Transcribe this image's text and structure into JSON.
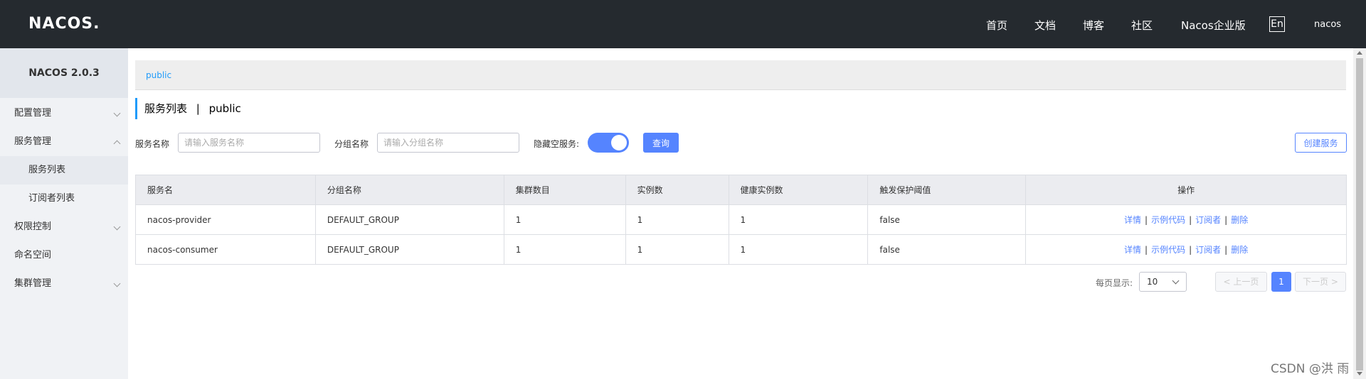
{
  "header": {
    "logo": "NACOS.",
    "nav": [
      "首页",
      "文档",
      "博客",
      "社区",
      "Nacos企业版"
    ],
    "lang": "En",
    "user": "nacos"
  },
  "sidebar": {
    "version": "NACOS 2.0.3",
    "items": [
      {
        "label": "配置管理"
      },
      {
        "label": "服务管理"
      },
      {
        "label": "服务列表"
      },
      {
        "label": "订阅者列表"
      },
      {
        "label": "权限控制"
      },
      {
        "label": "命名空间"
      },
      {
        "label": "集群管理"
      }
    ]
  },
  "breadcrumb": "public",
  "page": {
    "title": "服务列表",
    "separator": "|",
    "namespace": "public"
  },
  "filters": {
    "service_label": "服务名称",
    "service_placeholder": "请输入服务名称",
    "group_label": "分组名称",
    "group_placeholder": "请输入分组名称",
    "hide_empty_label": "隐藏空服务:",
    "hide_empty_on": true,
    "query_button": "查询",
    "create_button": "创建服务"
  },
  "table": {
    "headers": [
      "服务名",
      "分组名称",
      "集群数目",
      "实例数",
      "健康实例数",
      "触发保护阈值",
      "操作"
    ],
    "rows": [
      {
        "name": "nacos-provider",
        "group": "DEFAULT_GROUP",
        "clusters": "1",
        "instances": "1",
        "healthy": "1",
        "threshold": "false"
      },
      {
        "name": "nacos-consumer",
        "group": "DEFAULT_GROUP",
        "clusters": "1",
        "instances": "1",
        "healthy": "1",
        "threshold": "false"
      }
    ],
    "actions": {
      "detail": "详情",
      "sample": "示例代码",
      "subscriber": "订阅者",
      "delete": "删除",
      "sep": "|"
    }
  },
  "pagination": {
    "page_size_label": "每页显示:",
    "page_size": "10",
    "prev": "上一页",
    "current": "1",
    "next": "下一页"
  },
  "watermark": "CSDN @洪 雨",
  "colors": {
    "accent": "#5584ff",
    "header_bg": "#252a2f",
    "link": "#209bfa"
  }
}
